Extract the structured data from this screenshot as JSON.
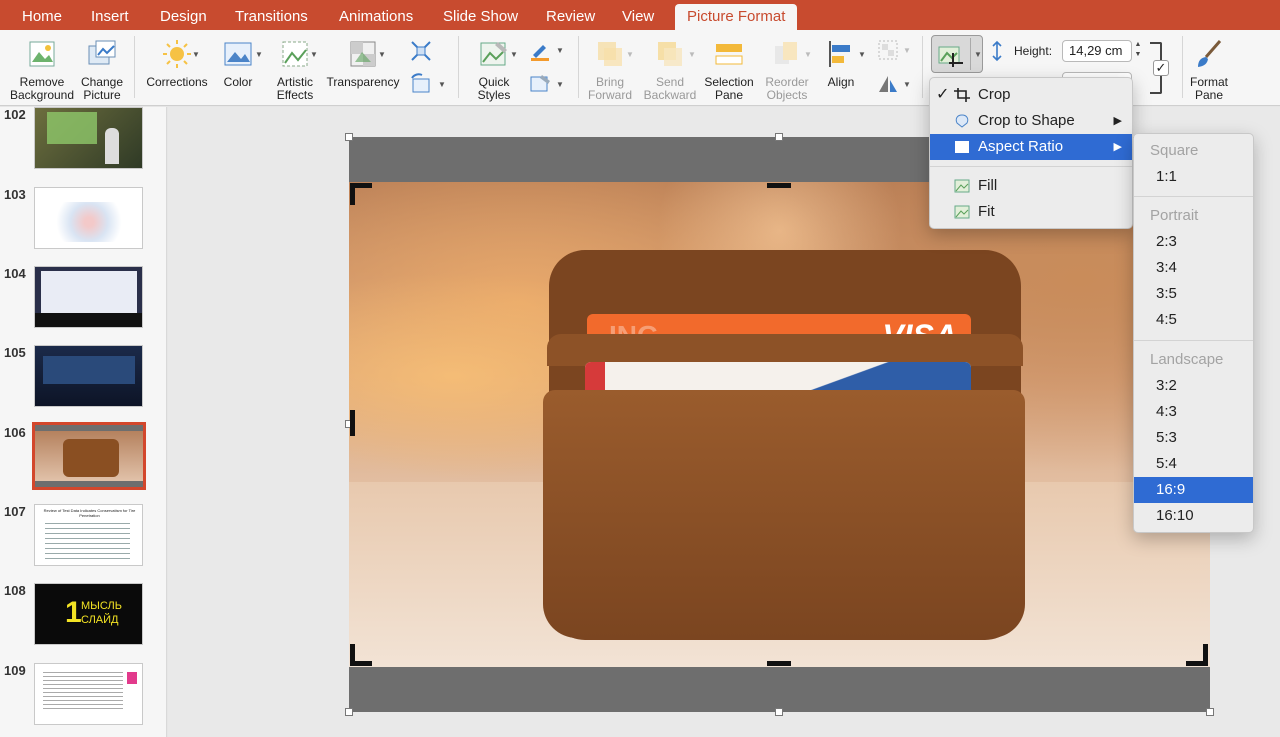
{
  "tabs": [
    "Home",
    "Insert",
    "Design",
    "Transitions",
    "Animations",
    "Slide Show",
    "Review",
    "View",
    "Picture Format"
  ],
  "ribbon": {
    "remove_bg": [
      "Remove",
      "Background"
    ],
    "change_pic": [
      "Change",
      "Picture"
    ],
    "corrections": "Corrections",
    "color": "Color",
    "artistic": [
      "Artistic",
      "Effects"
    ],
    "transparency": "Transparency",
    "quick_styles": [
      "Quick",
      "Styles"
    ],
    "bring_forward": [
      "Bring",
      "Forward"
    ],
    "send_backward": [
      "Send",
      "Backward"
    ],
    "selection_pane": [
      "Selection",
      "Pane"
    ],
    "reorder": [
      "Reorder",
      "Objects"
    ],
    "align": "Align",
    "height_label": "Height:",
    "height_value": "14,29 cm",
    "format_pane": [
      "Format",
      "Pane"
    ]
  },
  "slides": [
    {
      "num": "102"
    },
    {
      "num": "103"
    },
    {
      "num": "104"
    },
    {
      "num": "105"
    },
    {
      "num": "106"
    },
    {
      "num": "107",
      "title": "Review of Test Data Indicates Conservatism for Tire Penetration"
    },
    {
      "num": "108",
      "line1": "МЫСЛЬ",
      "line2": "СЛАЙД",
      "big": "1"
    },
    {
      "num": "109"
    }
  ],
  "crop_menu": {
    "check": "✓",
    "crop": "Crop",
    "crop_to_shape": "Crop to Shape",
    "aspect_ratio": "Aspect Ratio",
    "fill": "Fill",
    "fit": "Fit"
  },
  "aspect_menu": {
    "square_header": "Square",
    "square": [
      "1:1"
    ],
    "portrait_header": "Portrait",
    "portrait": [
      "2:3",
      "3:4",
      "3:5",
      "4:5"
    ],
    "landscape_header": "Landscape",
    "landscape": [
      "3:2",
      "4:3",
      "5:3",
      "5:4",
      "16:9",
      "16:10"
    ],
    "selected": "16:9"
  },
  "photo": {
    "card_text": "VISA",
    "bank_text": "ING"
  },
  "colors": {
    "accent": "#c84b2f",
    "menu_highlight": "#2f6bd3",
    "selection_border": "#d3472c"
  }
}
